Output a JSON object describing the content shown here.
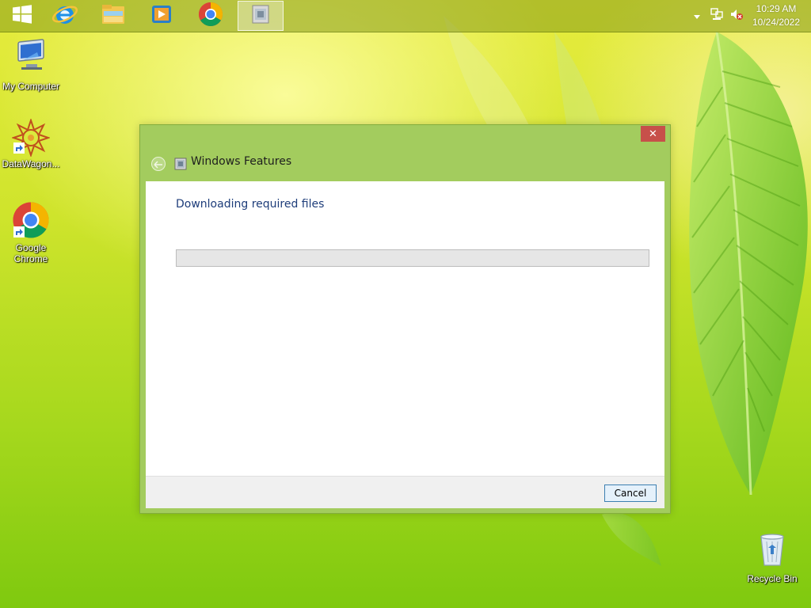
{
  "taskbar": {
    "apps": [
      {
        "name": "windows-start",
        "icon": "windows-logo-icon"
      },
      {
        "name": "internet-explorer",
        "icon": "internet-explorer-icon"
      },
      {
        "name": "file-explorer",
        "icon": "file-explorer-icon"
      },
      {
        "name": "windows-media-player",
        "icon": "media-player-icon"
      },
      {
        "name": "google-chrome",
        "icon": "chrome-icon"
      },
      {
        "name": "windows-features",
        "icon": "windows-features-icon",
        "active": true
      }
    ],
    "tray": {
      "icons": [
        "chevron-up-icon",
        "network-icon",
        "speaker-muted-icon"
      ],
      "time": "10:29 AM",
      "date": "10/24/2022"
    }
  },
  "desktop": {
    "icons": [
      {
        "label": "My Computer",
        "icon": "computer-icon"
      },
      {
        "label": "DataWagon...",
        "icon": "datawagon-icon"
      },
      {
        "label": "Google Chrome",
        "icon": "chrome-icon"
      },
      {
        "label": "Recycle Bin",
        "icon": "recycle-bin-icon"
      }
    ]
  },
  "dialog": {
    "title": "Windows Features",
    "heading": "Downloading required files",
    "progress": 0,
    "cancel_label": "Cancel",
    "close_glyph": "✕"
  },
  "colors": {
    "dialog_frame": "#a3cc5e",
    "heading_text": "#1e3d7a",
    "close_button": "#c7504a",
    "progress_track": "#e6e6e6"
  }
}
